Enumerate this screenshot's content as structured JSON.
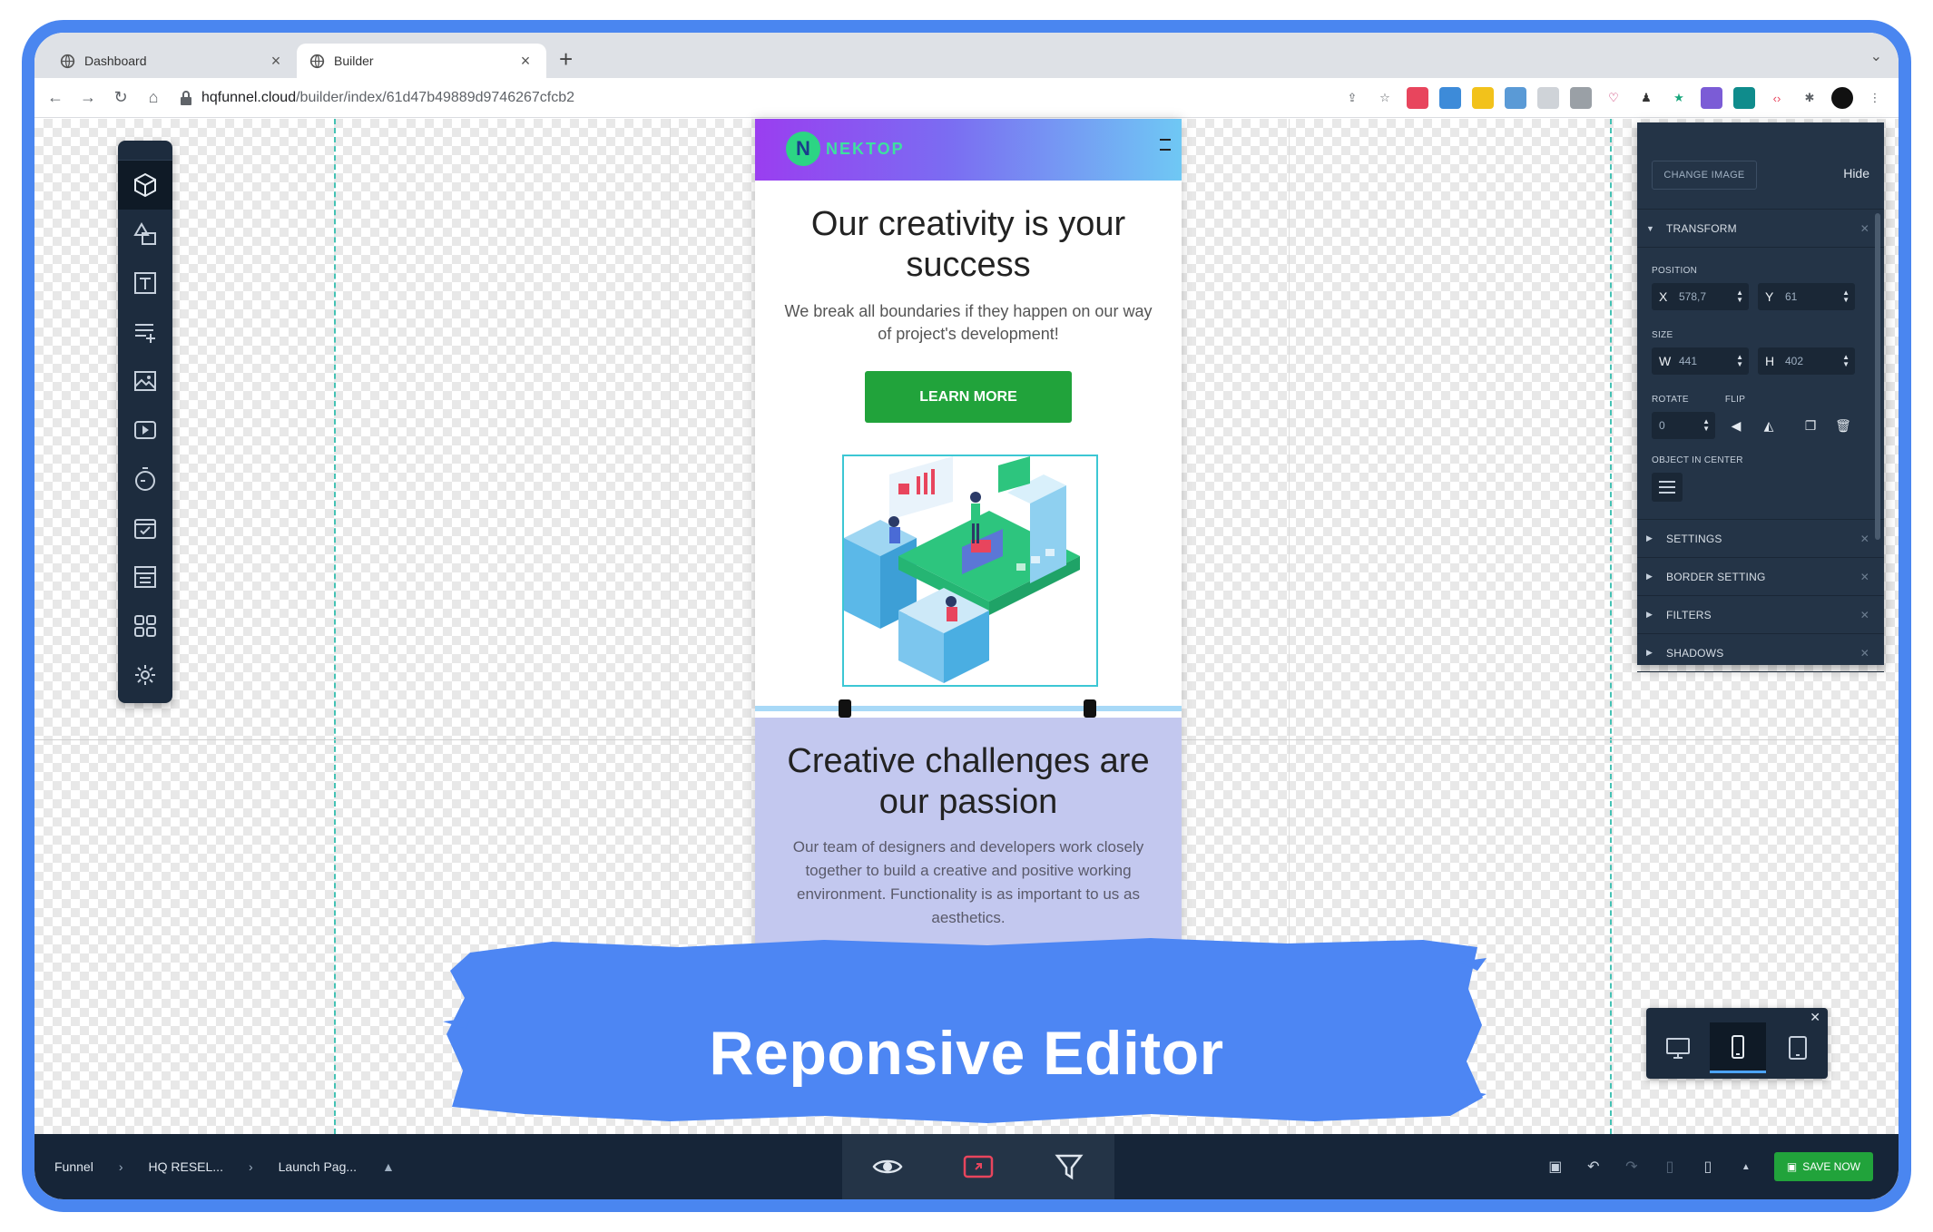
{
  "browser": {
    "tabs": [
      {
        "title": "Dashboard",
        "active": false
      },
      {
        "title": "Builder",
        "active": true
      }
    ],
    "new_tab_icon": "plus-icon",
    "url_host": "hqfunnel.cloud",
    "url_path": "/builder/index/61d47b49889d9746267cfcb2"
  },
  "page": {
    "logo_letter": "N",
    "logo_text": "NEKTOP",
    "hero_title": "Our creativity is your success",
    "hero_subtitle": "We break all boundaries if they happen on our way of project's development!",
    "hero_button": "LEARN MORE",
    "section2_title": "Creative challenges are our passion",
    "section2_text": "Our team of designers and developers work closely together to build a creative and positive working environment. Functionality is as important to us as aesthetics."
  },
  "panel": {
    "change_image": "CHANGE IMAGE",
    "hide": "Hide",
    "transform_label": "TRANSFORM",
    "position_label": "POSITION",
    "x_axis": "X",
    "x_value": "578,7",
    "y_axis": "Y",
    "y_value": "61",
    "size_label": "SIZE",
    "w_axis": "W",
    "w_value": "441",
    "h_axis": "H",
    "h_value": "402",
    "rotate_label": "ROTATE",
    "rotate_value": "0",
    "flip_label": "FLIP",
    "center_label": "OBJECT IN CENTER",
    "sections": [
      "SETTINGS",
      "BORDER SETTING",
      "FILTERS",
      "SHADOWS"
    ]
  },
  "banner": {
    "text": "Reponsive Editor",
    "color": "#4d86f3"
  },
  "bottom": {
    "crumbs": [
      "Funnel",
      "HQ RESEL...",
      "Launch Pag..."
    ],
    "save": "SAVE NOW"
  },
  "colors": {
    "accent": "#21a33b",
    "toolbar": "#1d2c3e",
    "frame": "#4a86f0"
  }
}
